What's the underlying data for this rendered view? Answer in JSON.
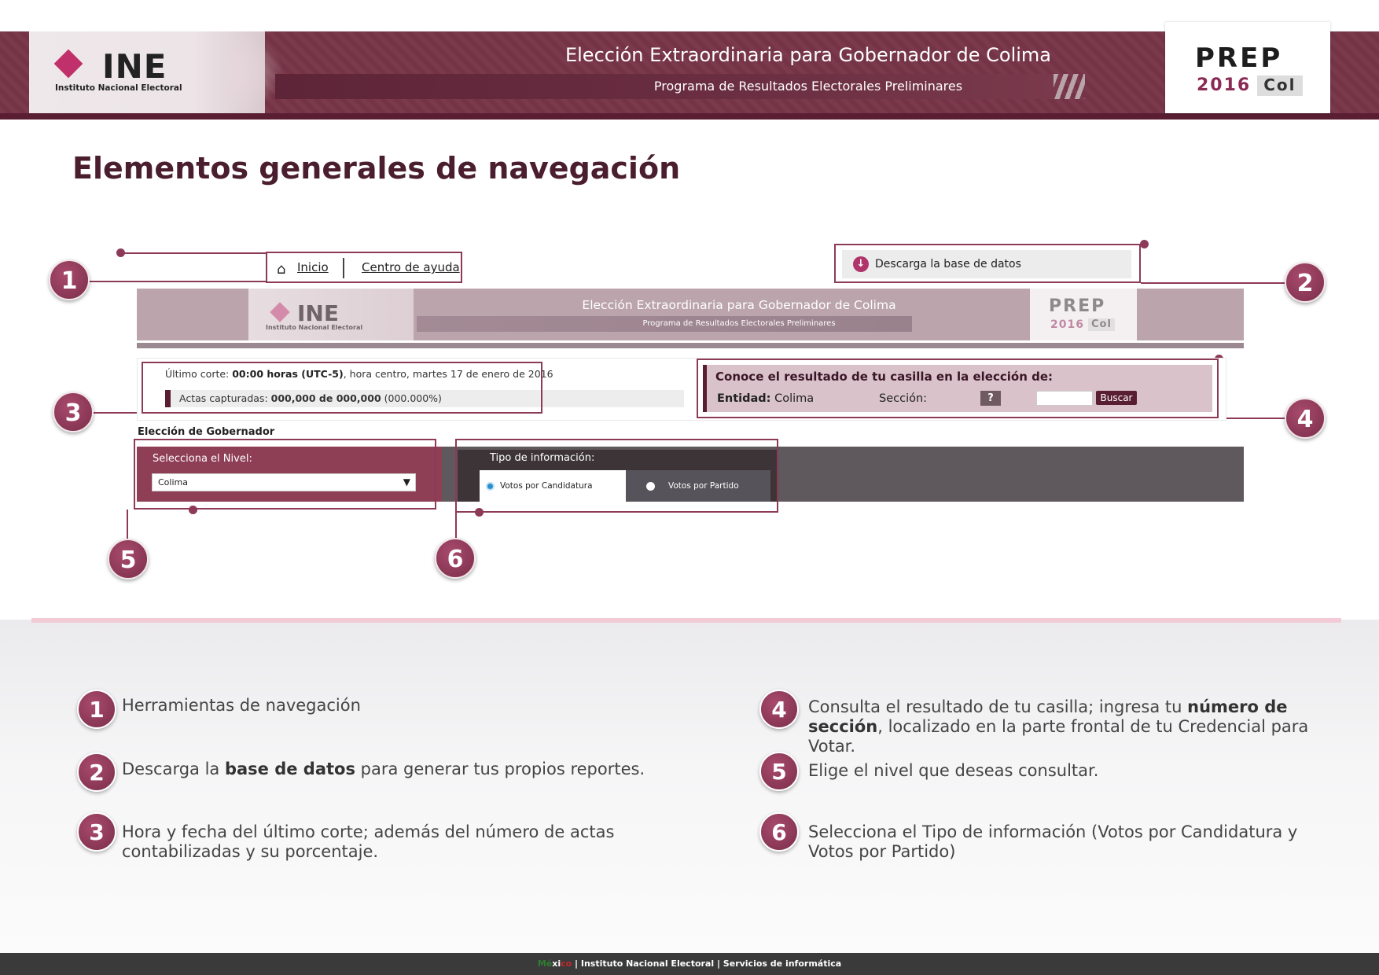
{
  "banner": {
    "logo_text": "INE",
    "logo_subtitle": "Instituto Nacional Electoral",
    "title": "Elección Extraordinaria para Gobernador de Colima",
    "subtitle": "Programa de Resultados Electorales Preliminares",
    "prep_word": "PREP",
    "prep_year": "2016",
    "prep_state": "Col"
  },
  "page_title": "Elementos generales de navegación",
  "mock": {
    "nav": {
      "home_label": "Inicio",
      "help_label": "Centro de ayuda"
    },
    "download_label": "Descarga la base de datos",
    "mini_banner": {
      "logo_text": "INE",
      "logo_subtitle": "Instituto Nacional Electoral",
      "title": "Elección Extraordinaria para Gobernador de Colima",
      "subtitle": "Programa de Resultados Electorales Preliminares",
      "prep_word": "PREP",
      "prep_year": "2016",
      "prep_state": "Col"
    },
    "cut": {
      "prefix": "Último corte: ",
      "time": "00:00 horas (UTC-5)",
      "suffix": ", hora centro, martes 17 de enero de 2016",
      "acts_prefix": "Actas capturadas: ",
      "acts_count": "000,000 de 000,000",
      "acts_pct": " (000.000%)"
    },
    "casilla": {
      "title": "Conoce el resultado de tu casilla en la elección de:",
      "entidad_label": "Entidad:",
      "entidad_value": " Colima",
      "seccion_label": "Sección:",
      "help": "?",
      "search_label": "Buscar"
    },
    "election_label": "Elección de Gobernador",
    "level": {
      "label": "Selecciona el Nivel:",
      "value": "Colima"
    },
    "info": {
      "label": "Tipo de información:",
      "option1": "Votos por Candidatura",
      "option2": "Votos por Partido"
    },
    "markers": [
      "1",
      "2",
      "3",
      "4",
      "5",
      "6"
    ]
  },
  "legend": [
    {
      "num": "1",
      "text_plain": "Herramientas de navegación"
    },
    {
      "num": "2",
      "pre": "Descarga la ",
      "bold": "base de datos",
      "post": " para generar tus propios reportes."
    },
    {
      "num": "3",
      "text_plain": "Hora y fecha del último corte; además del número de actas contabilizadas y su porcentaje."
    },
    {
      "num": "4",
      "pre": "Consulta el resultado de tu casilla; ingresa tu ",
      "bold": "número de sección",
      "post": ", localizado en la parte frontal de tu Credencial para Votar."
    },
    {
      "num": "5",
      "text_plain": "Elige el nivel que deseas consultar."
    },
    {
      "num": "6",
      "text_plain": "Selecciona el Tipo de información (Votos por Candidatura y Votos por Partido)"
    }
  ],
  "footer": {
    "mx_m": "Mé",
    "mx_x": "xi",
    "mx_c": "co",
    "rest": " | Instituto Nacional Electoral  | Servicios de informática"
  },
  "colors": {
    "brand": "#7a3a4c",
    "accent": "#8d3a58",
    "dark": "#5a1e33"
  }
}
